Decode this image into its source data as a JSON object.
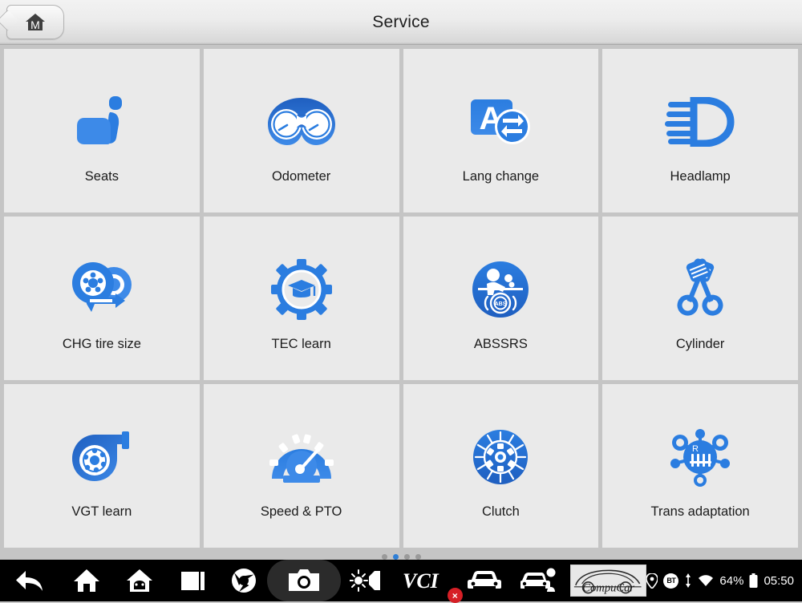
{
  "header": {
    "title": "Service",
    "home_button_label": "M",
    "home_button_icon": "home-m-icon"
  },
  "grid": {
    "tiles": [
      {
        "label": "Seats",
        "icon": "car-seat-icon"
      },
      {
        "label": "Odometer",
        "icon": "gauge-cluster-icon"
      },
      {
        "label": "Lang change",
        "icon": "language-swap-icon"
      },
      {
        "label": "Headlamp",
        "icon": "headlamp-icon"
      },
      {
        "label": "CHG tire size",
        "icon": "tire-change-icon"
      },
      {
        "label": "TEC learn",
        "icon": "gear-graduation-cap-icon"
      },
      {
        "label": "ABSSRS",
        "icon": "abs-srs-airbag-icon"
      },
      {
        "label": "Cylinder",
        "icon": "crossed-pistons-icon"
      },
      {
        "label": "VGT learn",
        "icon": "turbocharger-icon"
      },
      {
        "label": "Speed & PTO",
        "icon": "speedometer-icon"
      },
      {
        "label": "Clutch",
        "icon": "clutch-plate-icon"
      },
      {
        "label": "Trans adaptation",
        "icon": "gear-shift-pattern-icon"
      }
    ]
  },
  "pagination": {
    "total": 4,
    "active_index": 1
  },
  "navbar": {
    "items": [
      {
        "name": "back-button",
        "icon": "back-arrow-icon"
      },
      {
        "name": "home-button",
        "icon": "home-icon"
      },
      {
        "name": "android-home-button",
        "icon": "android-house-icon"
      },
      {
        "name": "recents-button",
        "icon": "recents-square-icon"
      },
      {
        "name": "browser-button",
        "icon": "chrome-icon"
      },
      {
        "name": "screenshot-button",
        "icon": "camera-icon"
      },
      {
        "name": "display-settings-button",
        "icon": "brightness-volume-icon"
      },
      {
        "name": "vci-button",
        "icon": "vci-icon",
        "label": "VCI",
        "badge": "×"
      },
      {
        "name": "vehicle-button",
        "icon": "car-front-icon"
      },
      {
        "name": "service-button",
        "icon": "car-service-icon"
      }
    ],
    "brand_logo": "CompuCar"
  },
  "status": {
    "location_icon": "location-pin-icon",
    "bluetooth_label": "BT",
    "usb_icon": "usb-transfer-icon",
    "wifi_icon": "wifi-icon",
    "battery_percent": "64%",
    "battery_icon": "battery-icon",
    "time": "05:50"
  },
  "colors": {
    "accent_blue": "#2f7fd6",
    "icon_blue": "#2b7de0",
    "icon_blue_dark": "#1f5fc0",
    "tile_bg": "#eaeaea",
    "grid_line": "#c5c5c5",
    "badge_red": "#d61f26"
  }
}
